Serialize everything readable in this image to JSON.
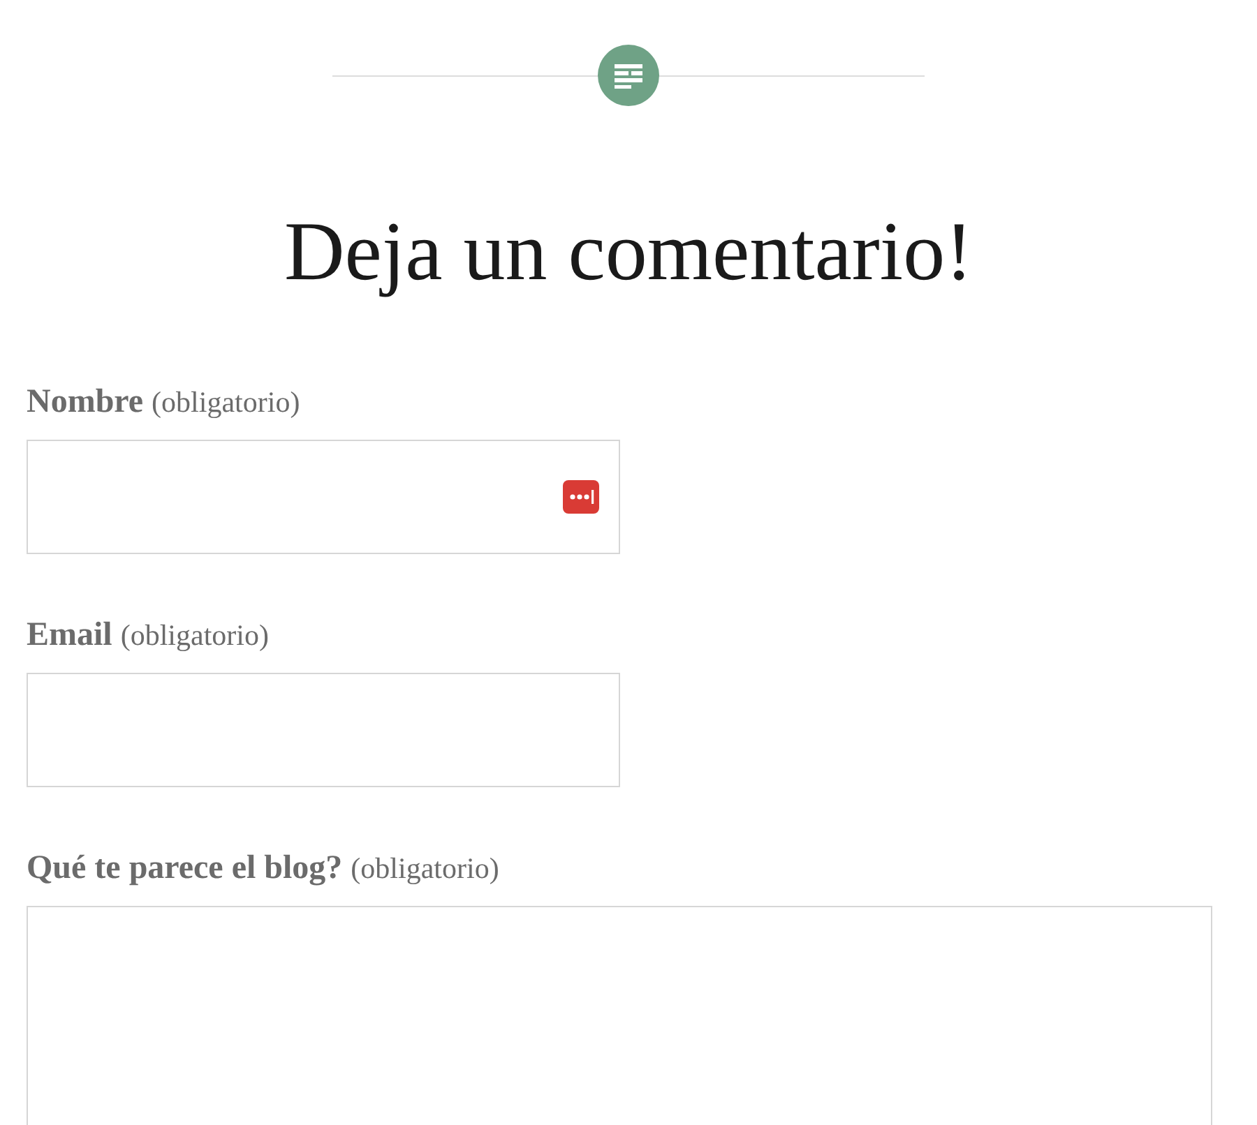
{
  "heading": "Deja un comentario!",
  "fields": [
    {
      "kind": "input_autofill",
      "label": "Nombre",
      "note": "(obligatorio)"
    },
    {
      "kind": "input",
      "label": "Email",
      "note": "(obligatorio)"
    },
    {
      "kind": "textarea",
      "label": "Qué te parece el blog?",
      "note": "(obligatorio)"
    }
  ]
}
